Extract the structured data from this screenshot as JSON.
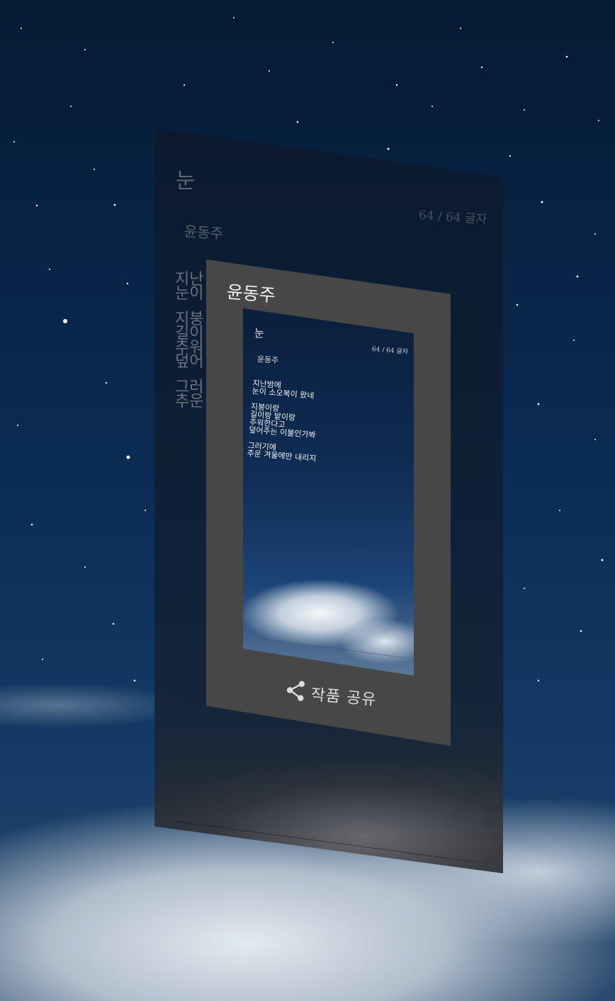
{
  "poem": {
    "title": "눈",
    "author": "윤동주",
    "char_count": "64 / 64 글자",
    "stanzas": [
      [
        "지난밤에",
        "눈이 소오복이 왔네"
      ],
      [
        "지붕이랑",
        "길이랑 밭이랑",
        "추워한다고",
        "덮어주는 이불인가봐"
      ],
      [
        "그러기에",
        "추운 겨울에만 내리지"
      ]
    ]
  },
  "share_panel": {
    "author": "윤동주",
    "share_label": "작품 공유",
    "share_icon": "share-icon"
  },
  "back_visible_lines": [
    "지난",
    "눈이",
    "지붕",
    "길이",
    "추워",
    "덮어",
    "그러",
    "추운"
  ]
}
